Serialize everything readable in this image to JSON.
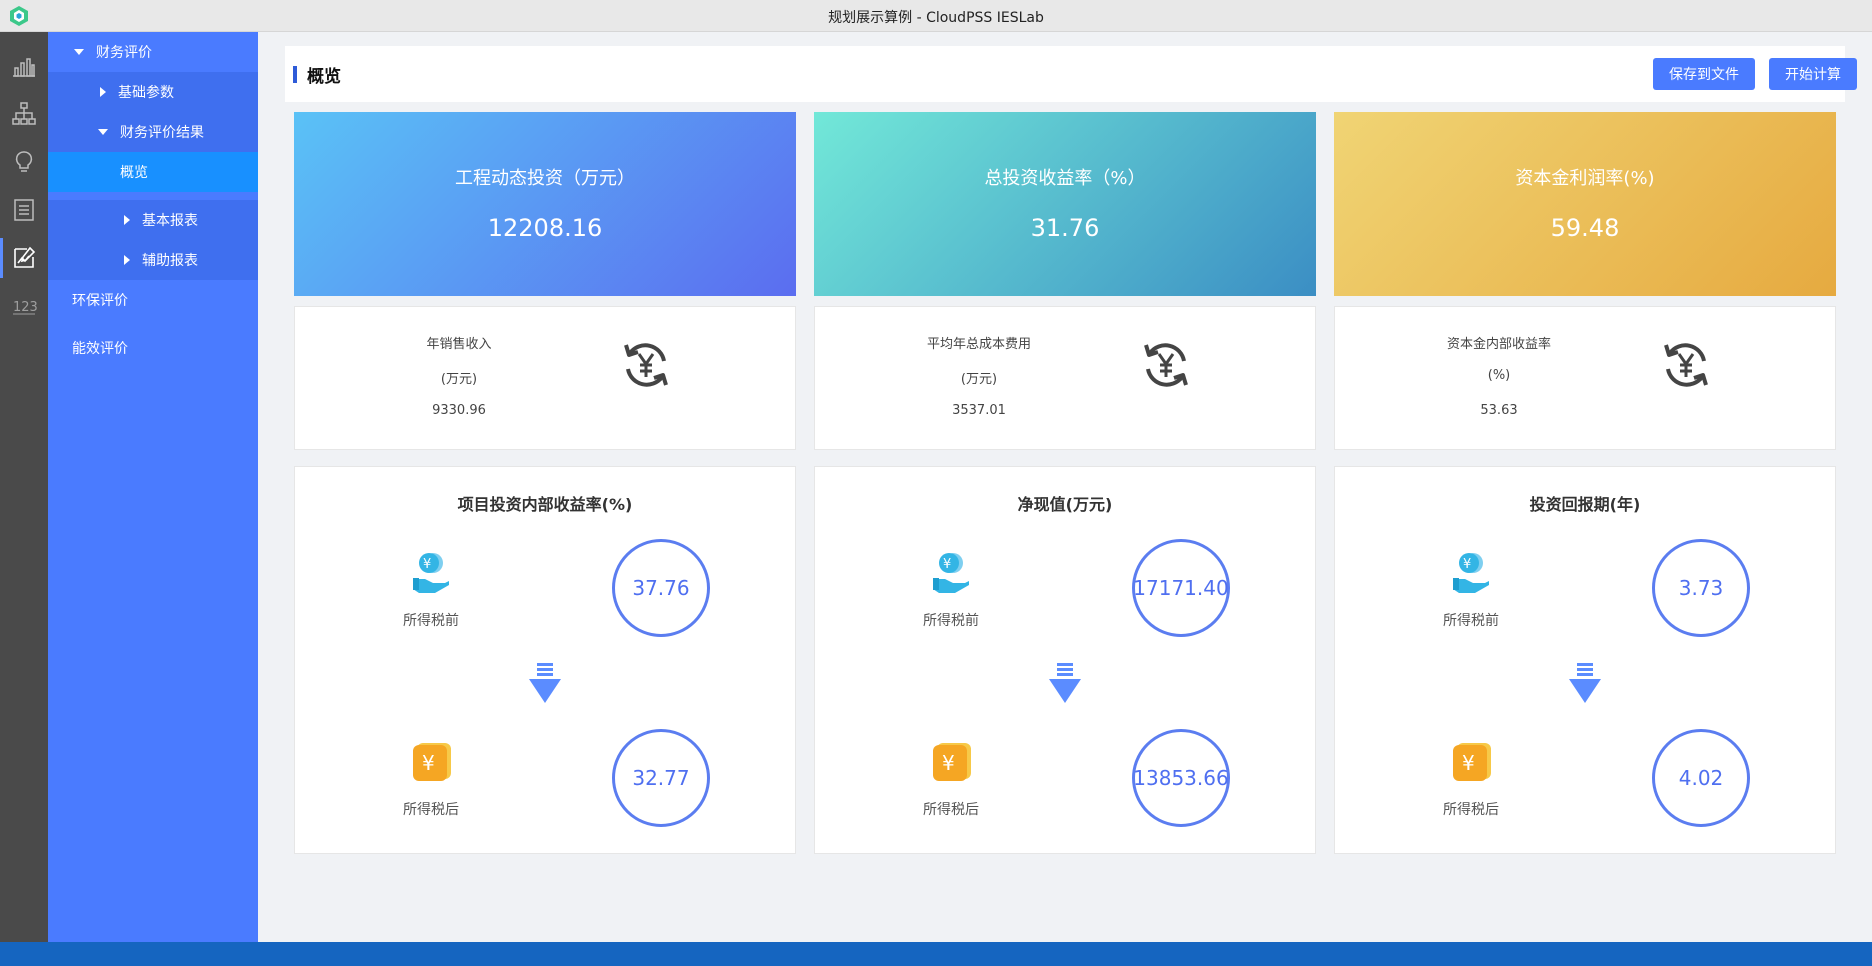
{
  "window": {
    "title": "规划展示算例 - CloudPSS IESLab"
  },
  "rail": {
    "icons": [
      "bar-chart-icon",
      "hierarchy-icon",
      "lightbulb-icon",
      "list-icon",
      "edit-chart-icon",
      "number-123-icon"
    ],
    "active_index": 4
  },
  "sidebar": {
    "items": [
      {
        "label": "财务评价",
        "level": 0,
        "expanded": true
      },
      {
        "label": "基础参数",
        "level": 1,
        "expanded": false
      },
      {
        "label": "财务评价结果",
        "level": 1,
        "expanded": true
      },
      {
        "label": "概览",
        "level": 2,
        "selected": true
      },
      {
        "label": "基本报表",
        "level": 2,
        "expanded": false
      },
      {
        "label": "辅助报表",
        "level": 2,
        "expanded": false
      },
      {
        "label": "环保评价",
        "level": 0
      },
      {
        "label": "能效评价",
        "level": 0
      }
    ]
  },
  "header": {
    "title": "概览",
    "save_label": "保存到文件",
    "calc_label": "开始计算"
  },
  "kpis": [
    {
      "title": "工程动态投资（万元）",
      "value": "12208.16"
    },
    {
      "title": "总投资收益率（%）",
      "value": "31.76"
    },
    {
      "title": "资本金利润率(%)",
      "value": "59.48"
    }
  ],
  "metrics": [
    {
      "label": "年销售收入",
      "unit": "(万元)",
      "value": "9330.96"
    },
    {
      "label": "平均年总成本费用",
      "unit": "(万元)",
      "value": "3537.01"
    },
    {
      "label": "资本金内部收益率",
      "unit": "(%)",
      "value": "53.63"
    }
  ],
  "comparisons": [
    {
      "title": "项目投资内部收益率(%)",
      "before_label": "所得税前",
      "before_value": "37.76",
      "after_label": "所得税后",
      "after_value": "32.77"
    },
    {
      "title": "净现值(万元)",
      "before_label": "所得税前",
      "before_value": "17171.40",
      "after_label": "所得税后",
      "after_value": "13853.66"
    },
    {
      "title": "投资回报期(年)",
      "before_label": "所得税前",
      "before_value": "3.73",
      "after_label": "所得税后",
      "after_value": "4.02"
    }
  ],
  "colors": {
    "sidebar": "#4a7bff",
    "selected": "#1890ff",
    "button": "#4a7bff",
    "ring": "#5b7df0",
    "footer": "#1565c0"
  }
}
